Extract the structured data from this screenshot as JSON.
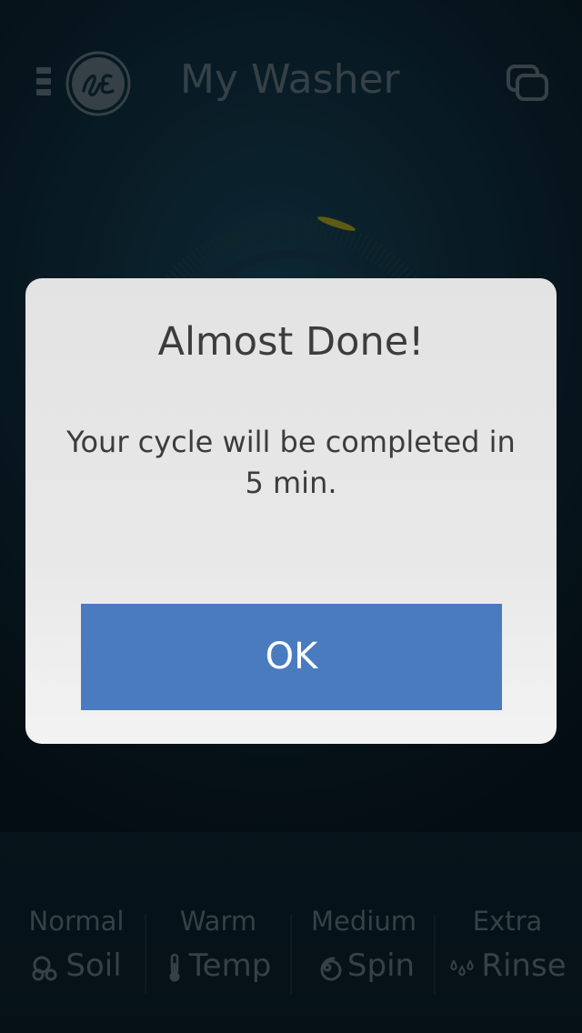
{
  "header": {
    "title": "My Washer",
    "menu_icon": "menu-icon",
    "logo": "ge-logo",
    "windows_icon": "multiple-windows-icon"
  },
  "settings": [
    {
      "value": "Normal",
      "label": "Soil",
      "icon": "soil-icon"
    },
    {
      "value": "Warm",
      "label": "Temp",
      "icon": "thermometer-icon"
    },
    {
      "value": "Medium",
      "label": "Spin",
      "icon": "spin-icon"
    },
    {
      "value": "Extra",
      "label": "Rinse",
      "icon": "droplets-icon"
    }
  ],
  "dialog": {
    "title": "Almost Done!",
    "message": "Your cycle will be completed in 5 min.",
    "ok_label": "OK"
  },
  "colors": {
    "background": "#0c2532",
    "dialog_background": "#e6e6e6",
    "button": "#4a7bbe",
    "muted_text": "#4a5a61",
    "accent_glow": "#e0c000"
  }
}
